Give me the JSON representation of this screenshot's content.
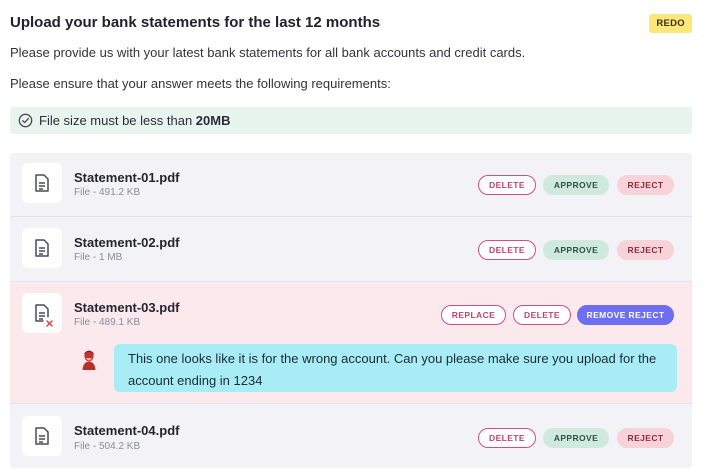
{
  "header": {
    "title": "Upload your bank statements for the last 12 months",
    "badge": "REDO"
  },
  "description": {
    "line1": "Please provide us with your latest bank statements for all bank accounts and credit cards.",
    "line2": "Please ensure that your answer meets the following requirements:"
  },
  "requirement": {
    "icon": "check-circle-icon",
    "text": "File size must be less than ",
    "value": "20MB"
  },
  "files": [
    {
      "name": "Statement-01.pdf",
      "meta": "File - 491.2 KB",
      "actions": [
        "DELETE",
        "APPROVE",
        "REJECT"
      ]
    },
    {
      "name": "Statement-02.pdf",
      "meta": "File - 1 MB",
      "actions": [
        "DELETE",
        "APPROVE",
        "REJECT"
      ]
    },
    {
      "name": "Statement-03.pdf",
      "meta": "File - 489.1 KB",
      "status": "rejected",
      "actions": [
        "REPLACE",
        "DELETE",
        "REMOVE REJECT"
      ],
      "comment": "This one looks like it is for the wrong account. Can you please make sure you upload for the account ending in 1234"
    },
    {
      "name": "Statement-04.pdf",
      "meta": "File - 504.2 KB",
      "actions": [
        "DELETE",
        "APPROVE",
        "REJECT"
      ]
    }
  ],
  "colors": {
    "badge_bg": "#fbe77a",
    "requirement_bg": "#e8f5ee",
    "rejected_row_bg": "#fbe9ee",
    "comment_bg": "#a8ecf5",
    "approve_bg": "#cfe9df",
    "reject_bg": "#f8d2d9",
    "remove_reject_bg": "#6f6ef0",
    "delete_border": "#d24e84"
  }
}
